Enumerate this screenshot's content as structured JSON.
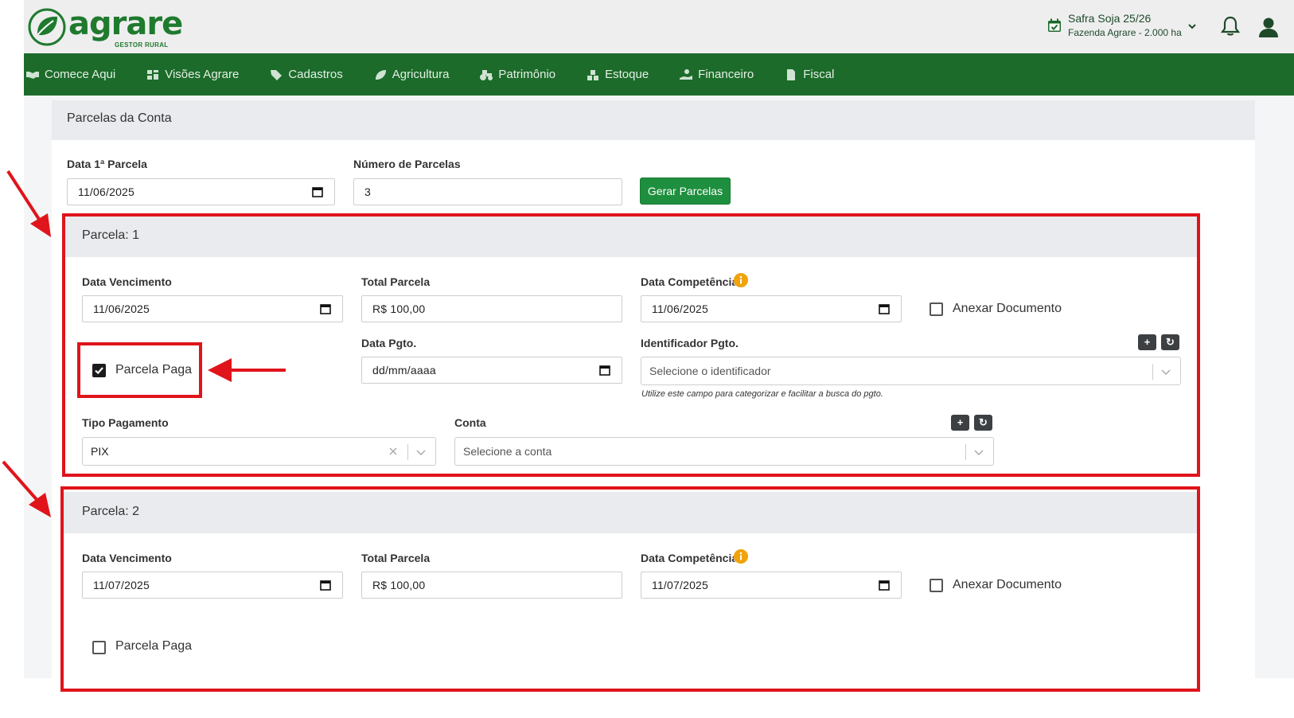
{
  "header": {
    "logo_text": "agrare",
    "logo_subtitle": "GESTOR RURAL",
    "safra_title": "Safra Soja 25/26",
    "safra_farm": "Fazenda Agrare - 2.000 ha"
  },
  "nav": {
    "items": [
      {
        "label": "Comece Aqui",
        "icon": "handshake-icon"
      },
      {
        "label": "Visões Agrare",
        "icon": "dashboard-icon"
      },
      {
        "label": "Cadastros",
        "icon": "tag-icon"
      },
      {
        "label": "Agricultura",
        "icon": "leaf-icon"
      },
      {
        "label": "Patrimônio",
        "icon": "tractor-icon"
      },
      {
        "label": "Estoque",
        "icon": "boxes-icon"
      },
      {
        "label": "Financeiro",
        "icon": "money-hand-icon"
      },
      {
        "label": "Fiscal",
        "icon": "document-icon"
      }
    ]
  },
  "card": {
    "title": "Parcelas da Conta",
    "first_date_label": "Data 1ª Parcela",
    "first_date_value": "11/06/2025",
    "num_parcelas_label": "Número de Parcelas",
    "num_parcelas_value": "3",
    "generate_button": "Gerar Parcelas"
  },
  "parcelas": [
    {
      "title": "Parcela: 1",
      "due_date_label": "Data Vencimento",
      "due_date": "11/06/2025",
      "total_label": "Total Parcela",
      "total": "R$ 100,00",
      "competencia_label": "Data Competência",
      "competencia": "11/06/2025",
      "attach_label": "Anexar Documento",
      "paid_label": "Parcela Paga",
      "paid": true,
      "payment_date_label": "Data Pgto.",
      "payment_date_placeholder": "dd/mm/aaaa",
      "identifier_label": "Identificador Pgto.",
      "identifier_placeholder": "Selecione o identificador",
      "identifier_hint": "Utilize este campo para categorizar e facilitar a busca do pgto.",
      "payment_type_label": "Tipo Pagamento",
      "payment_type": "PIX",
      "account_label": "Conta",
      "account_placeholder": "Selecione a conta"
    },
    {
      "title": "Parcela: 2",
      "due_date_label": "Data Vencimento",
      "due_date": "11/07/2025",
      "total_label": "Total Parcela",
      "total": "R$ 100,00",
      "competencia_label": "Data Competência",
      "competencia": "11/07/2025",
      "attach_label": "Anexar Documento",
      "paid_label": "Parcela Paga",
      "paid": false
    }
  ],
  "mini_buttons": {
    "add": "+",
    "refresh": "↻"
  },
  "colors": {
    "brand_green": "#1c6b2a",
    "button_green": "#1e8f3e",
    "annotation_red": "#e0141b",
    "info_orange": "#f0a30a"
  }
}
